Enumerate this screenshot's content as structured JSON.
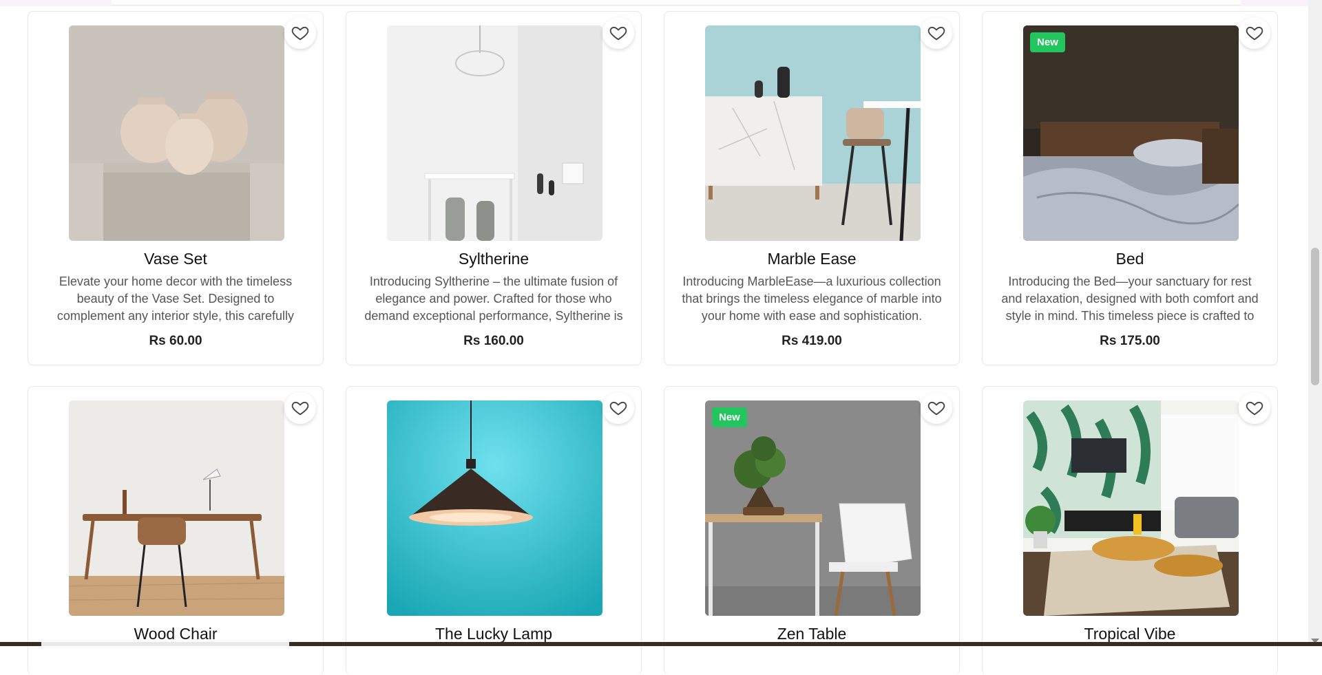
{
  "products_row1": [
    {
      "title": "Vase Set",
      "description": "Elevate your home decor with the timeless beauty of the Vase Set. Designed to complement any interior style, this carefully curated set of vases...",
      "price": "Rs 60.00",
      "badge": ""
    },
    {
      "title": "Syltherine",
      "description": "Introducing Syltherine – the ultimate fusion of elegance and power. Crafted for those who demand exceptional performance, Syltherine is a...",
      "price": "Rs 160.00",
      "badge": ""
    },
    {
      "title": "Marble Ease",
      "description": "Introducing MarbleEase—a luxurious collection that brings the timeless elegance of marble into your home with ease and sophistication. Design...",
      "price": "Rs 419.00",
      "badge": ""
    },
    {
      "title": "Bed",
      "description": "Introducing the Bed—your sanctuary for rest and relaxation, designed with both comfort and style in mind. This timeless piece is crafted to transfor...",
      "price": "Rs 175.00",
      "badge": "New"
    }
  ],
  "products_row2": [
    {
      "title": "Wood Chair",
      "badge": ""
    },
    {
      "title": "The Lucky Lamp",
      "badge": ""
    },
    {
      "title": "Zen Table",
      "badge": "New"
    },
    {
      "title": "Tropical Vibe",
      "badge": ""
    }
  ],
  "colors": {
    "badge_bg": "#22c55e",
    "heart_stroke": "#444444"
  },
  "icons": {
    "wishlist": "heart-icon"
  }
}
